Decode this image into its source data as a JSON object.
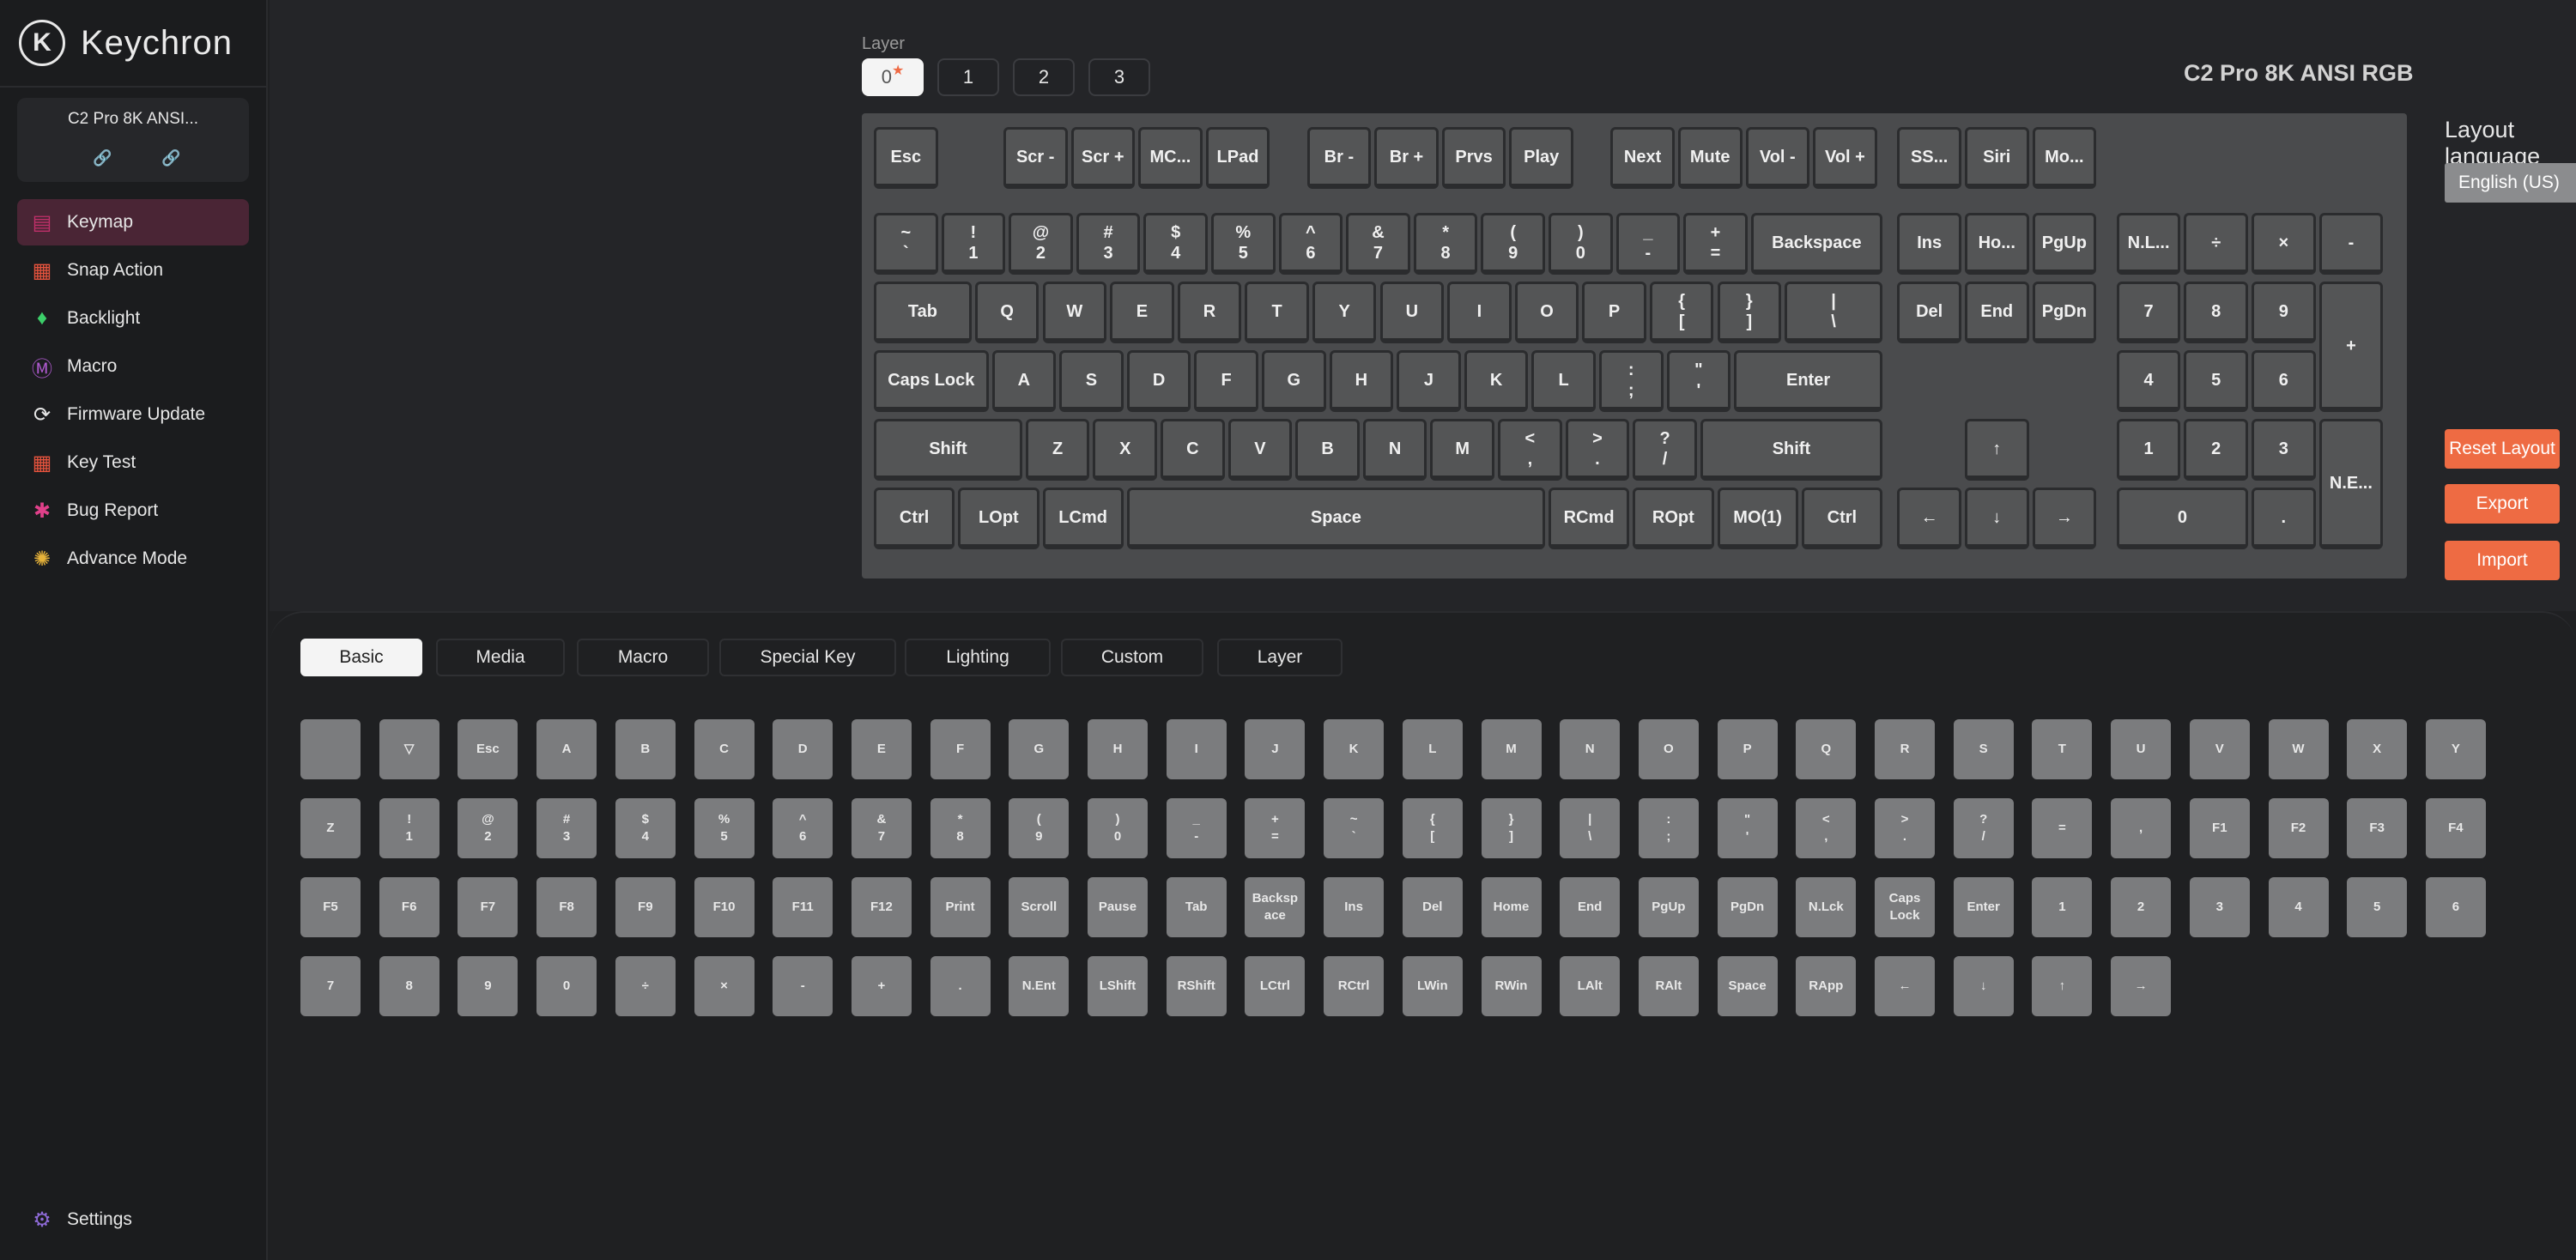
{
  "app": {
    "logo_mark": "K",
    "logo_text": "Keychron"
  },
  "device": {
    "name": "C2 Pro 8K ANSI...",
    "icon_left": "🔗",
    "icon_right": "🔗"
  },
  "sidebar": {
    "items": [
      {
        "label": "Keymap",
        "icon": "keyboard-icon",
        "glyph": "▤",
        "color": "#c0306a"
      },
      {
        "label": "Snap Action",
        "icon": "snap-action-icon",
        "glyph": "▦",
        "color": "#e5533d"
      },
      {
        "label": "Backlight",
        "icon": "bulb-icon",
        "glyph": "♦",
        "color": "#3ccf6a"
      },
      {
        "label": "Macro",
        "icon": "macro-icon",
        "glyph": "Ⓜ",
        "color": "#b05ad0"
      },
      {
        "label": "Firmware Update",
        "icon": "firmware-icon",
        "glyph": "⟳",
        "color": "#e6e6e6"
      },
      {
        "label": "Key Test",
        "icon": "key-test-icon",
        "glyph": "▦",
        "color": "#e5533d"
      },
      {
        "label": "Bug Report",
        "icon": "bug-icon",
        "glyph": "✱",
        "color": "#e0408a"
      },
      {
        "label": "Advance Mode",
        "icon": "advance-mode-icon",
        "glyph": "✺",
        "color": "#e6b23a"
      }
    ],
    "settings": {
      "label": "Settings",
      "icon": "gear-icon",
      "glyph": "⚙",
      "color": "#8f6bd8"
    }
  },
  "layers": {
    "title": "Layer",
    "tabs": [
      "0",
      "1",
      "2",
      "3"
    ],
    "active": "0",
    "star": "★"
  },
  "keyboard_name": "C2 Pro 8K ANSI RGB",
  "keyboard": {
    "row0": [
      "Esc",
      "Scr -",
      "Scr +",
      "MC...",
      "LPad",
      "Br -",
      "Br +",
      "Prvs",
      "Play",
      "Next",
      "Mute",
      "Vol -",
      "Vol +",
      "SS...",
      "Siri",
      "Mo..."
    ],
    "row1": [
      "~\n`",
      "!\n1",
      "@\n2",
      "#\n3",
      "$\n4",
      "%\n5",
      "^\n6",
      "&\n7",
      "*\n8",
      "(\n9",
      ")\n0",
      "_\n-",
      "+\n=",
      "Backspace",
      "Ins",
      "Ho...",
      "PgUp",
      "N.L...",
      "÷",
      "×",
      "-"
    ],
    "row2": [
      "Tab",
      "Q",
      "W",
      "E",
      "R",
      "T",
      "Y",
      "U",
      "I",
      "O",
      "P",
      "{\n[",
      "}\n]",
      "|\n\\",
      "Del",
      "End",
      "PgDn",
      "7",
      "8",
      "9",
      "+"
    ],
    "row3": [
      "Caps Lock",
      "A",
      "S",
      "D",
      "F",
      "G",
      "H",
      "J",
      "K",
      "L",
      ":\n;",
      "\"\n'",
      "Enter",
      "4",
      "5",
      "6"
    ],
    "row4": [
      "Shift",
      "Z",
      "X",
      "C",
      "V",
      "B",
      "N",
      "M",
      "<\n,",
      ">\n.",
      "?\n/",
      "Shift",
      "↑",
      "1",
      "2",
      "3",
      "N.E..."
    ],
    "row5": [
      "Ctrl",
      "LOpt",
      "LCmd",
      "Space",
      "RCmd",
      "ROpt",
      "MO(1)",
      "Ctrl",
      "←",
      "↓",
      "→",
      "0",
      "."
    ]
  },
  "layout_language": {
    "title": "Layout language",
    "value": "English (US)",
    "chevron": "⌵"
  },
  "actions": {
    "reset": "Reset Layout",
    "export": "Export",
    "import": "Import"
  },
  "categories": {
    "tabs": [
      "Basic",
      "Media",
      "Macro",
      "Special Key",
      "Lighting",
      "Custom",
      "Layer"
    ],
    "active": "Basic"
  },
  "palette": {
    "rows": [
      [
        "",
        "▽",
        "Esc",
        "A",
        "B",
        "C",
        "D",
        "E",
        "F",
        "G",
        "H",
        "I",
        "J",
        "K",
        "L",
        "M",
        "N",
        "O",
        "P",
        "Q",
        "R",
        "S",
        "T",
        "U",
        "V",
        "W",
        "X",
        "Y"
      ],
      [
        "Z",
        "!\n1",
        "@\n2",
        "#\n3",
        "$\n4",
        "%\n5",
        "^\n6",
        "&\n7",
        "*\n8",
        "(\n9",
        ")\n0",
        "_\n-",
        "+\n=",
        "~\n`",
        "{\n[",
        "}\n]",
        "|\n\\",
        ":\n;",
        "\"\n'",
        "<\n,",
        ">\n.",
        "?\n/",
        "=",
        ",",
        "F1",
        "F2",
        "F3",
        "F4"
      ],
      [
        "F5",
        "F6",
        "F7",
        "F8",
        "F9",
        "F10",
        "F11",
        "F12",
        "Print",
        "Scroll",
        "Pause",
        "Tab",
        "Backsp\nace",
        "Ins",
        "Del",
        "Home",
        "End",
        "PgUp",
        "PgDn",
        "N.Lck",
        "Caps\nLock",
        "Enter",
        "1",
        "2",
        "3",
        "4",
        "5",
        "6"
      ],
      [
        "7",
        "8",
        "9",
        "0",
        "÷",
        "×",
        "-",
        "+",
        ".",
        "N.Ent",
        "LShift",
        "RShift",
        "LCtrl",
        "RCtrl",
        "LWin",
        "RWin",
        "LAlt",
        "RAlt",
        "Space",
        "RApp",
        "←",
        "↓",
        "↑",
        "→"
      ]
    ]
  }
}
